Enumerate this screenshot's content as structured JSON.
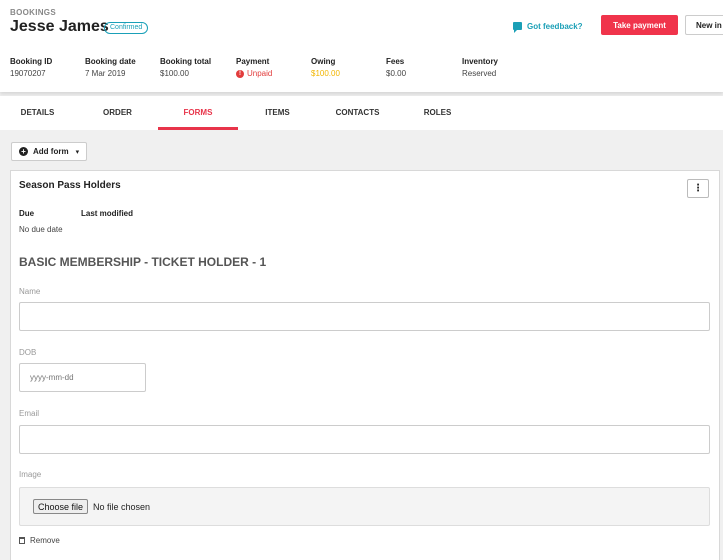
{
  "header": {
    "breadcrumb": "BOOKINGS",
    "title": "Jesse James",
    "status_badge": "Confirmed",
    "feedback_label": "Got feedback?",
    "take_payment_label": "Take payment",
    "new_label": "New in"
  },
  "summary": {
    "booking_id": {
      "label": "Booking ID",
      "value": "19070207"
    },
    "booking_date": {
      "label": "Booking date",
      "value": "7 Mar 2019"
    },
    "booking_total": {
      "label": "Booking total",
      "value": "$100.00"
    },
    "payment": {
      "label": "Payment",
      "value": "Unpaid",
      "icon": "alert-icon"
    },
    "owing": {
      "label": "Owing",
      "value": "$100.00"
    },
    "fees": {
      "label": "Fees",
      "value": "$0.00"
    },
    "inventory": {
      "label": "Inventory",
      "value": "Reserved"
    }
  },
  "tabs": [
    {
      "label": "DETAILS"
    },
    {
      "label": "ORDER"
    },
    {
      "label": "FORMS",
      "active": true
    },
    {
      "label": "ITEMS"
    },
    {
      "label": "CONTACTS"
    },
    {
      "label": "ROLES"
    }
  ],
  "toolbar": {
    "add_form_label": "Add form"
  },
  "card": {
    "title": "Season Pass Holders",
    "kebab": "⋮",
    "due_label": "Due",
    "modified_label": "Last modified",
    "due_value": "No due date",
    "section_title": "BASIC MEMBERSHIP - TICKET HOLDER - 1",
    "fields": {
      "name_label": "Name",
      "name_value": "",
      "dob_label": "DOB",
      "dob_placeholder": "yyyy-mm-dd",
      "email_label": "Email",
      "email_value": "",
      "image_label": "Image",
      "choose_file_label": "Choose file",
      "no_file_label": "No file chosen"
    },
    "remove_label": "Remove"
  },
  "colors": {
    "accent": "#e8344a",
    "badge": "#1aa0b8",
    "owing": "#f2b600",
    "unpaid": "#e23c3c"
  }
}
